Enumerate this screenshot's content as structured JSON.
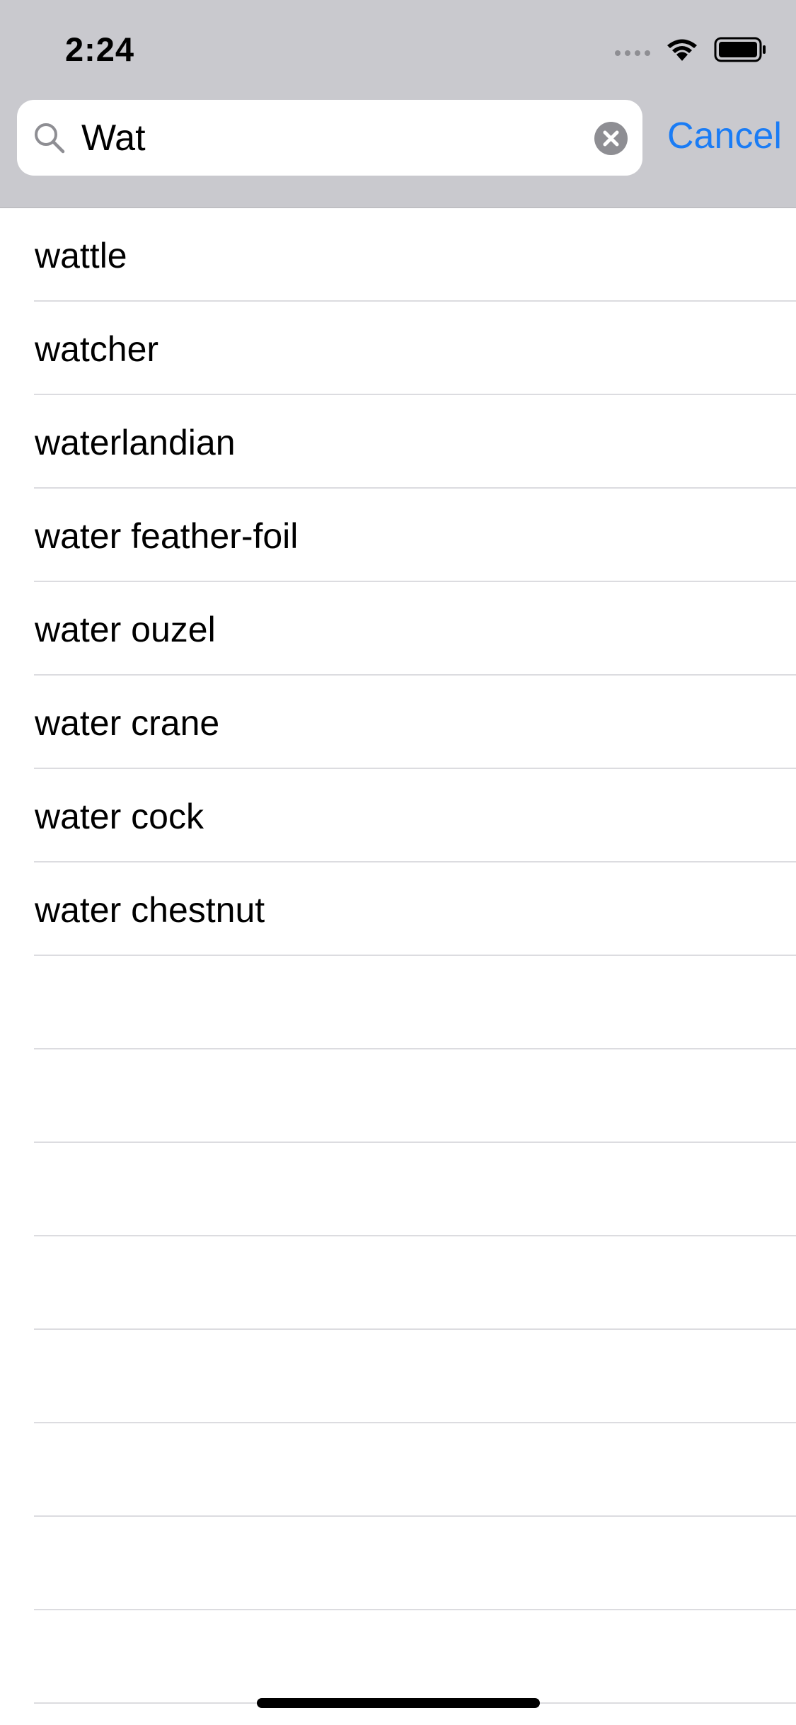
{
  "status_bar": {
    "time": "2:24"
  },
  "search": {
    "query": "Wat",
    "cancel_label": "Cancel"
  },
  "results": [
    "wattle",
    "watcher",
    "waterlandian",
    "water feather-foil",
    "water ouzel",
    "water crane",
    "water cock",
    "water chestnut",
    "",
    "",
    "",
    "",
    "",
    "",
    "",
    ""
  ],
  "colors": {
    "header_bg": "#c9c9ce",
    "accent": "#1a7cf5",
    "separator": "#dcdce0"
  },
  "icons": [
    "search-icon",
    "clear-icon",
    "wifi-icon",
    "battery-icon",
    "cellular-signal-icon"
  ]
}
